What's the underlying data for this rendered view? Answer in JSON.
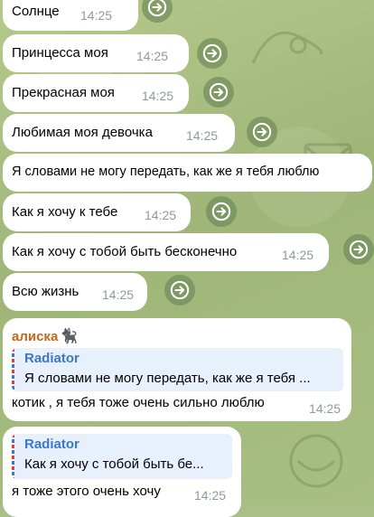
{
  "messages": [
    {
      "text": "Солнце",
      "time": "14:25"
    },
    {
      "text": "Принцесса моя",
      "time": "14:25"
    },
    {
      "text": "Прекрасная моя",
      "time": "14:25"
    },
    {
      "text": "Любимая моя девочка",
      "time": "14:25"
    },
    {
      "text": "Я словами не могу передать, как же я тебя люблю",
      "time": ""
    },
    {
      "text": "Как я хочу к тебе",
      "time": "14:25"
    },
    {
      "text": "Как я хочу с тобой быть бесконечно",
      "time": "14:25"
    },
    {
      "text": "Всю жизнь",
      "time": "14:25"
    }
  ],
  "replies": [
    {
      "sender": "алиска",
      "sender_emoji": "🐈‍⬛",
      "quote_name": "Radiator",
      "quote_text": "Я словами не могу передать, как же я тебя ...",
      "text": "котик , я тебя тоже очень сильно люблю",
      "time": "14:25"
    },
    {
      "quote_name": "Radiator",
      "quote_text": "Как я хочу с тобой быть бе...",
      "text": "я тоже этого очень хочу",
      "time": "14:25"
    }
  ],
  "icons": {
    "forward": "forward-arrow-icon"
  },
  "colors": {
    "bubble": "#ffffff",
    "sender": "#c8651b",
    "quote_name": "#3a78c9",
    "time": "#8c9a9e"
  }
}
